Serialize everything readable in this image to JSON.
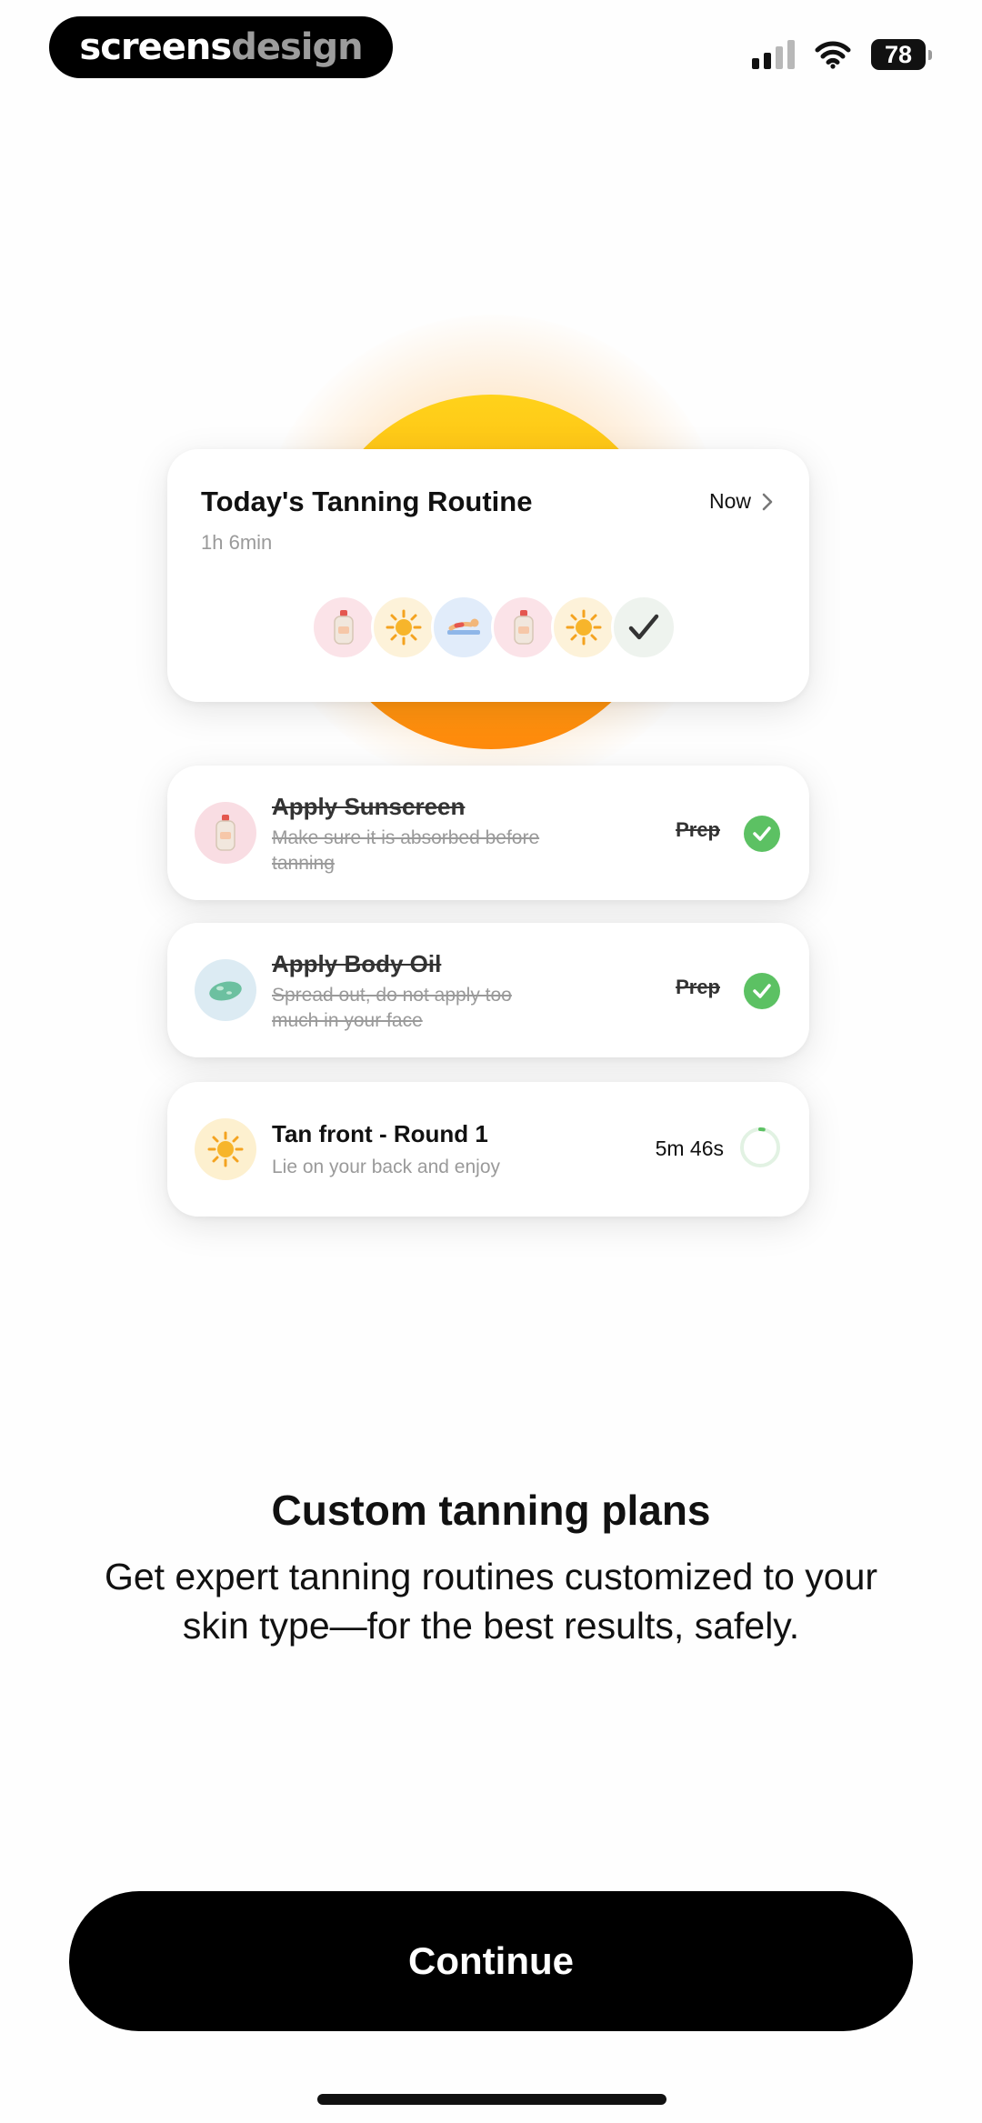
{
  "status_bar": {
    "brand_part1": "screens",
    "brand_part2": "design",
    "battery_level": "78"
  },
  "routine": {
    "title": "Today's Tanning Routine",
    "duration": "1h 6min",
    "action_label": "Now",
    "steps": [
      {
        "icon": "sunscreen-bottle-icon",
        "bg": "#fbe3e8"
      },
      {
        "icon": "sun-icon",
        "bg": "#fdf2d9"
      },
      {
        "icon": "sunbathing-person-icon",
        "bg": "#e1ecfa"
      },
      {
        "icon": "sunscreen-bottle-icon",
        "bg": "#fbe3e8"
      },
      {
        "icon": "sun-icon",
        "bg": "#fdf2d9"
      },
      {
        "icon": "checkmark-icon",
        "bg": "#eef3ee"
      }
    ]
  },
  "tasks": [
    {
      "title": "Apply Sunscreen",
      "description": "Make sure it is absorbed before tanning",
      "tag": "Prep",
      "status": "done",
      "icon": "sunscreen-bottle-icon"
    },
    {
      "title": "Apply Body Oil",
      "description": "Spread out, do not apply too much in your face",
      "tag": "Prep",
      "status": "done",
      "icon": "body-oil-icon"
    },
    {
      "title": "Tan front - Round 1",
      "description": "Lie on your back and enjoy",
      "timer": "5m 46s",
      "status": "in-progress",
      "progress": 0.03,
      "icon": "sun-icon"
    }
  ],
  "onboarding": {
    "title": "Custom tanning plans",
    "subtitle": "Get expert tanning routines customized to your skin type—for the best results, safely."
  },
  "continue_label": "Continue",
  "colors": {
    "accent_green": "#5cc163",
    "sun_top": "#ffd21a",
    "sun_bottom": "#ff8a0d",
    "button_bg": "#000000"
  }
}
